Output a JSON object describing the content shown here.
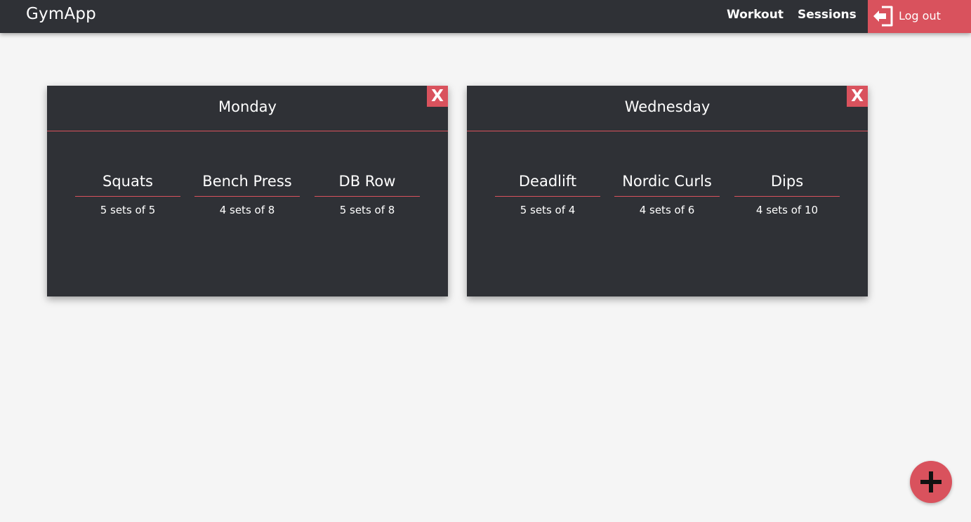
{
  "navbar": {
    "brand": "GymApp",
    "links": [
      "Workout",
      "Sessions"
    ],
    "logout_label": "Log out",
    "logout_icon": "sign-out-icon"
  },
  "workouts": [
    {
      "day": "Monday",
      "close_label": "X",
      "exercises": [
        {
          "name": "Squats",
          "sets": "5 sets of 5"
        },
        {
          "name": "Bench Press",
          "sets": "4 sets of 8"
        },
        {
          "name": "DB Row",
          "sets": "5 sets of 8"
        }
      ]
    },
    {
      "day": "Wednesday",
      "close_label": "X",
      "exercises": [
        {
          "name": "Deadlift",
          "sets": "5 sets of 4"
        },
        {
          "name": "Nordic Curls",
          "sets": "4 sets of 6"
        },
        {
          "name": "Dips",
          "sets": "4 sets of 10"
        }
      ]
    }
  ],
  "fab": {
    "icon": "plus-icon"
  },
  "colors": {
    "accent": "#d9525d",
    "surface": "#2f3136",
    "background": "#f5f5f5"
  }
}
